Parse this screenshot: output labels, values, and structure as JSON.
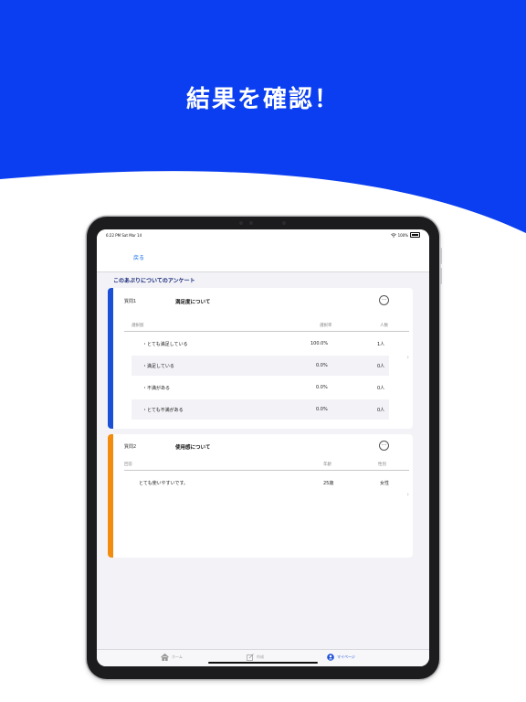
{
  "colors": {
    "brand_blue": "#0a3ef0",
    "q1_accent": "#1a4fd6",
    "q2_accent": "#f28c0f"
  },
  "headline": "結果を確認！",
  "status": {
    "time": "6:22 PM  Sat Mar 14",
    "battery": "100%"
  },
  "nav": {
    "back_label": "戻る"
  },
  "section_title": "このあぷりについてのアンケート",
  "questions": [
    {
      "label": "質問1",
      "title": "満足度について",
      "columns": [
        "選択肢",
        "選択率",
        "人数"
      ],
      "rows": [
        {
          "choice": "・とても満足している",
          "rate": "100.0%",
          "count": "1人"
        },
        {
          "choice": "・満足している",
          "rate": "0.0%",
          "count": "0人"
        },
        {
          "choice": "・不満がある",
          "rate": "0.0%",
          "count": "0人"
        },
        {
          "choice": "・とても不満がある",
          "rate": "0.0%",
          "count": "0人"
        }
      ]
    },
    {
      "label": "質問2",
      "title": "使用感について",
      "columns": [
        "回答",
        "年齢",
        "性別"
      ],
      "rows": [
        {
          "answer": "とても使いやすいです。",
          "age": "25歳",
          "gender": "女性"
        }
      ]
    }
  ],
  "tabs": [
    {
      "label": "ホーム",
      "icon": "home-icon"
    },
    {
      "label": "作成",
      "icon": "compose-icon"
    },
    {
      "label": "マイページ",
      "icon": "person-icon",
      "active": true
    }
  ],
  "more_glyph": "···",
  "chevron_glyph": "›"
}
